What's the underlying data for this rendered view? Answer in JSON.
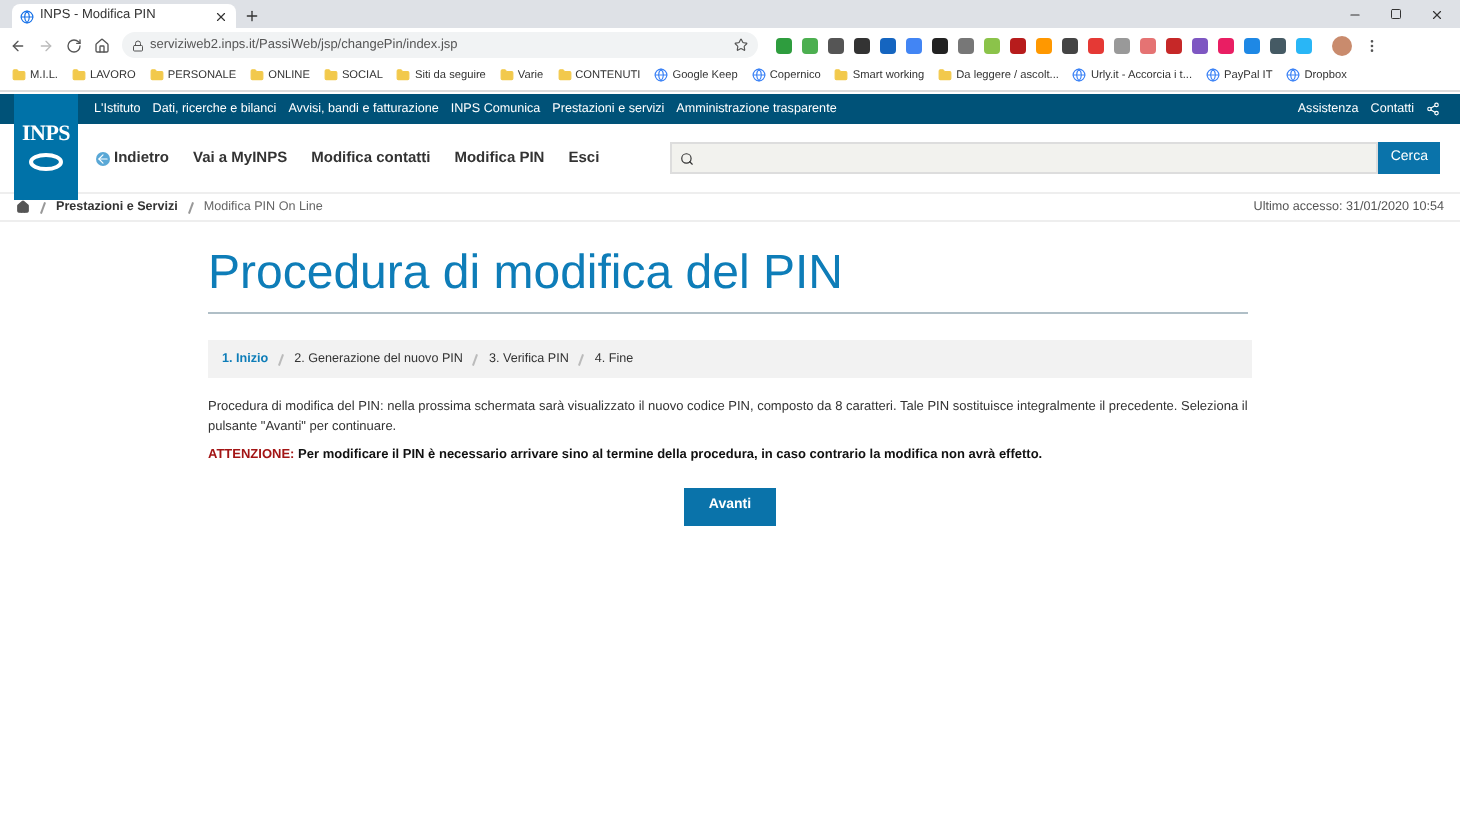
{
  "browser": {
    "tab_title": "INPS - Modifica PIN",
    "url": "serviziweb2.inps.it/PassiWeb/jsp/changePin/index.jsp",
    "bookmarks": [
      {
        "label": "M.I.L.",
        "kind": "folder"
      },
      {
        "label": "LAVORO",
        "kind": "folder"
      },
      {
        "label": "PERSONALE",
        "kind": "folder"
      },
      {
        "label": "ONLINE",
        "kind": "folder"
      },
      {
        "label": "SOCIAL",
        "kind": "folder"
      },
      {
        "label": "Siti da seguire",
        "kind": "folder"
      },
      {
        "label": "Varie",
        "kind": "folder"
      },
      {
        "label": "CONTENUTI",
        "kind": "folder"
      },
      {
        "label": "Google Keep",
        "kind": "site"
      },
      {
        "label": "Copernico",
        "kind": "site"
      },
      {
        "label": "Smart working",
        "kind": "folder"
      },
      {
        "label": "Da leggere / ascolt...",
        "kind": "folder"
      },
      {
        "label": "Urly.it - Accorcia i t...",
        "kind": "site"
      },
      {
        "label": "PayPal IT",
        "kind": "site"
      },
      {
        "label": "Dropbox",
        "kind": "site"
      }
    ]
  },
  "site": {
    "logo_text": "INPS",
    "top_nav": [
      "L'Istituto",
      "Dati, ricerche e bilanci",
      "Avvisi, bandi e fatturazione",
      "INPS Comunica",
      "Prestazioni e servizi",
      "Amministrazione trasparente"
    ],
    "utility_links": [
      "Assistenza",
      "Contatti"
    ],
    "header_links": [
      {
        "label": "Indietro",
        "kind": "back"
      },
      {
        "label": "Vai a MyINPS",
        "kind": "link"
      },
      {
        "label": "Modifica contatti",
        "kind": "link"
      },
      {
        "label": "Modifica PIN",
        "kind": "link"
      },
      {
        "label": "Esci",
        "kind": "link"
      }
    ],
    "search_button": "Cerca",
    "breadcrumb": [
      "Prestazioni e Servizi",
      "Modifica PIN On Line"
    ],
    "last_access": "Ultimo accesso: 31/01/2020 10:54"
  },
  "page": {
    "title": "Procedura di modifica del PIN",
    "steps": [
      {
        "label": "1. Inizio",
        "selected": true
      },
      {
        "label": "2. Generazione del nuovo PIN",
        "selected": false
      },
      {
        "label": "3. Verifica PIN",
        "selected": false
      },
      {
        "label": "4. Fine",
        "selected": false
      }
    ],
    "description": "Procedura di modifica del PIN: nella prossima schermata sarà visualizzato il nuovo codice PIN, composto da 8 caratteri. Tale PIN sostituisce integralmente il precedente. Seleziona il pulsante \"Avanti\" per continuare.",
    "warning_label": "ATTENZIONE:",
    "warning_text": "Per modificare il PIN è necessario arrivare sino al termine della procedura, in caso contrario la modifica non avrà effetto.",
    "button": "Avanti"
  }
}
